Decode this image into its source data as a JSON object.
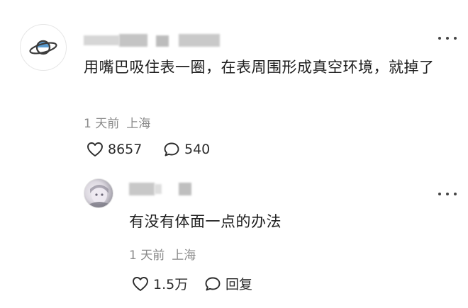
{
  "comment": {
    "avatar_icon": "planet-icon",
    "text": "用嘴巴吸住表一圈，在表周围形成真空环境，就掉了",
    "time": "1 天前",
    "location": "上海",
    "likes": "8657",
    "replies": "540",
    "more_icon": "more-dots-icon"
  },
  "reply": {
    "text": "有没有体面一点的办法",
    "time": "1 天前",
    "location": "上海",
    "likes": "1.5万",
    "reply_label": "回复",
    "more_icon": "more-dots-icon"
  },
  "colors": {
    "text": "#1e1e1e",
    "meta": "#8a8a8a",
    "icon": "#2b2b2b",
    "planet": "#4a90c8",
    "blur": "#cfcfcf"
  }
}
